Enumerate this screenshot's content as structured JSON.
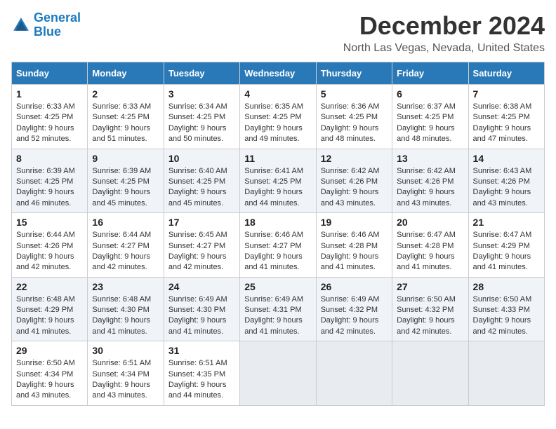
{
  "header": {
    "logo_line1": "General",
    "logo_line2": "Blue",
    "month_title": "December 2024",
    "location": "North Las Vegas, Nevada, United States"
  },
  "weekdays": [
    "Sunday",
    "Monday",
    "Tuesday",
    "Wednesday",
    "Thursday",
    "Friday",
    "Saturday"
  ],
  "weeks": [
    [
      {
        "day": 1,
        "sunrise": "6:33 AM",
        "sunset": "4:25 PM",
        "daylight": "9 hours and 52 minutes."
      },
      {
        "day": 2,
        "sunrise": "6:33 AM",
        "sunset": "4:25 PM",
        "daylight": "9 hours and 51 minutes."
      },
      {
        "day": 3,
        "sunrise": "6:34 AM",
        "sunset": "4:25 PM",
        "daylight": "9 hours and 50 minutes."
      },
      {
        "day": 4,
        "sunrise": "6:35 AM",
        "sunset": "4:25 PM",
        "daylight": "9 hours and 49 minutes."
      },
      {
        "day": 5,
        "sunrise": "6:36 AM",
        "sunset": "4:25 PM",
        "daylight": "9 hours and 48 minutes."
      },
      {
        "day": 6,
        "sunrise": "6:37 AM",
        "sunset": "4:25 PM",
        "daylight": "9 hours and 48 minutes."
      },
      {
        "day": 7,
        "sunrise": "6:38 AM",
        "sunset": "4:25 PM",
        "daylight": "9 hours and 47 minutes."
      }
    ],
    [
      {
        "day": 8,
        "sunrise": "6:39 AM",
        "sunset": "4:25 PM",
        "daylight": "9 hours and 46 minutes."
      },
      {
        "day": 9,
        "sunrise": "6:39 AM",
        "sunset": "4:25 PM",
        "daylight": "9 hours and 45 minutes."
      },
      {
        "day": 10,
        "sunrise": "6:40 AM",
        "sunset": "4:25 PM",
        "daylight": "9 hours and 45 minutes."
      },
      {
        "day": 11,
        "sunrise": "6:41 AM",
        "sunset": "4:25 PM",
        "daylight": "9 hours and 44 minutes."
      },
      {
        "day": 12,
        "sunrise": "6:42 AM",
        "sunset": "4:26 PM",
        "daylight": "9 hours and 43 minutes."
      },
      {
        "day": 13,
        "sunrise": "6:42 AM",
        "sunset": "4:26 PM",
        "daylight": "9 hours and 43 minutes."
      },
      {
        "day": 14,
        "sunrise": "6:43 AM",
        "sunset": "4:26 PM",
        "daylight": "9 hours and 43 minutes."
      }
    ],
    [
      {
        "day": 15,
        "sunrise": "6:44 AM",
        "sunset": "4:26 PM",
        "daylight": "9 hours and 42 minutes."
      },
      {
        "day": 16,
        "sunrise": "6:44 AM",
        "sunset": "4:27 PM",
        "daylight": "9 hours and 42 minutes."
      },
      {
        "day": 17,
        "sunrise": "6:45 AM",
        "sunset": "4:27 PM",
        "daylight": "9 hours and 42 minutes."
      },
      {
        "day": 18,
        "sunrise": "6:46 AM",
        "sunset": "4:27 PM",
        "daylight": "9 hours and 41 minutes."
      },
      {
        "day": 19,
        "sunrise": "6:46 AM",
        "sunset": "4:28 PM",
        "daylight": "9 hours and 41 minutes."
      },
      {
        "day": 20,
        "sunrise": "6:47 AM",
        "sunset": "4:28 PM",
        "daylight": "9 hours and 41 minutes."
      },
      {
        "day": 21,
        "sunrise": "6:47 AM",
        "sunset": "4:29 PM",
        "daylight": "9 hours and 41 minutes."
      }
    ],
    [
      {
        "day": 22,
        "sunrise": "6:48 AM",
        "sunset": "4:29 PM",
        "daylight": "9 hours and 41 minutes."
      },
      {
        "day": 23,
        "sunrise": "6:48 AM",
        "sunset": "4:30 PM",
        "daylight": "9 hours and 41 minutes."
      },
      {
        "day": 24,
        "sunrise": "6:49 AM",
        "sunset": "4:30 PM",
        "daylight": "9 hours and 41 minutes."
      },
      {
        "day": 25,
        "sunrise": "6:49 AM",
        "sunset": "4:31 PM",
        "daylight": "9 hours and 41 minutes."
      },
      {
        "day": 26,
        "sunrise": "6:49 AM",
        "sunset": "4:32 PM",
        "daylight": "9 hours and 42 minutes."
      },
      {
        "day": 27,
        "sunrise": "6:50 AM",
        "sunset": "4:32 PM",
        "daylight": "9 hours and 42 minutes."
      },
      {
        "day": 28,
        "sunrise": "6:50 AM",
        "sunset": "4:33 PM",
        "daylight": "9 hours and 42 minutes."
      }
    ],
    [
      {
        "day": 29,
        "sunrise": "6:50 AM",
        "sunset": "4:34 PM",
        "daylight": "9 hours and 43 minutes."
      },
      {
        "day": 30,
        "sunrise": "6:51 AM",
        "sunset": "4:34 PM",
        "daylight": "9 hours and 43 minutes."
      },
      {
        "day": 31,
        "sunrise": "6:51 AM",
        "sunset": "4:35 PM",
        "daylight": "9 hours and 44 minutes."
      },
      null,
      null,
      null,
      null
    ]
  ]
}
